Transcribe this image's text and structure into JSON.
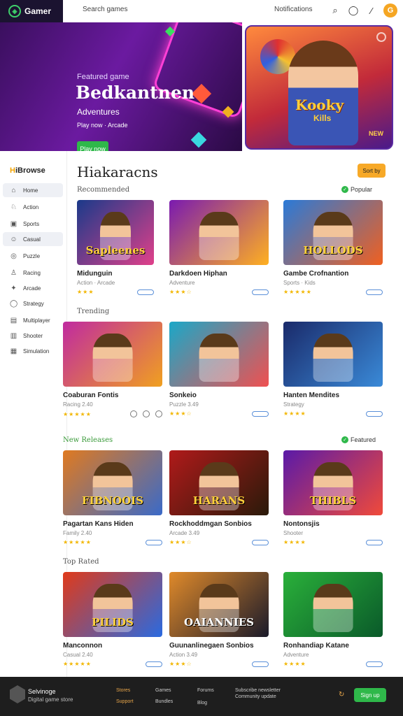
{
  "topbar": {
    "brand": "Gamer",
    "search_placeholder": "Search games",
    "account_label": "Notifications",
    "avatar_initial": "G"
  },
  "hero": {
    "eyebrow": "Featured game",
    "title": "Bedkantnen",
    "subtitle": "Adventures",
    "meta": "Play now · Arcade",
    "cta": "Play now",
    "art_title": "Kooky",
    "art_subtitle": "Kills",
    "art_badge": "NEW"
  },
  "sidebar": {
    "title_highlight": "H",
    "title_rest": "iBrowse",
    "items": [
      {
        "icon": "⌂",
        "label": "Home"
      },
      {
        "icon": "♘",
        "label": "Action"
      },
      {
        "icon": "▣",
        "label": "Sports"
      },
      {
        "icon": "☺",
        "label": "Casual"
      },
      {
        "icon": "◎",
        "label": "Puzzle"
      },
      {
        "icon": "♙",
        "label": "Racing"
      },
      {
        "icon": "✦",
        "label": "Arcade"
      },
      {
        "icon": "◯",
        "label": "Strategy"
      },
      {
        "icon": "▤",
        "label": "Multiplayer"
      },
      {
        "icon": "▥",
        "label": "Shooter"
      },
      {
        "icon": "▦",
        "label": "Simulation"
      }
    ]
  },
  "main": {
    "title": "Hiakaracns",
    "sort_button": "Sort by"
  },
  "sections": [
    {
      "label": "Recommended",
      "tag": "Popular",
      "tag_green": true
    },
    {
      "label": "Trending",
      "tag": "",
      "tag_green": false
    },
    {
      "label": "New Releases",
      "tag": "Featured",
      "tag_green": true
    },
    {
      "label": "Top Rated",
      "tag": "",
      "tag_green": false
    }
  ],
  "games": [
    {
      "name": "Midunguin",
      "meta": "Action · Arcade",
      "stars": "★★★",
      "thumb_text": "Sapleenes",
      "c1": "#1a3a8a",
      "c2": "#e0408a",
      "tc": "#ffcf3a"
    },
    {
      "name": "Darkdoen Hiphan",
      "meta": "Adventure",
      "stars": "★★★☆",
      "thumb_text": "",
      "c1": "#7a1ab0",
      "c2": "#ffb020",
      "tc": "#fff"
    },
    {
      "name": "Gambe Crofnantion",
      "meta": "Sports · Kids",
      "stars": "★★★★★",
      "thumb_text": "HOLLODS",
      "c1": "#2a7ad8",
      "c2": "#f06020",
      "tc": "#ffd23a"
    },
    {
      "name": "Coaburan Fontis",
      "meta": "Racing 2.40",
      "stars": "★★★★★",
      "thumb_text": "",
      "c1": "#c02aa0",
      "c2": "#f0a020",
      "tc": "#fff"
    },
    {
      "name": "Sonkeio",
      "meta": "Puzzle 3.49",
      "stars": "★★★☆",
      "thumb_text": "",
      "c1": "#1aa8c8",
      "c2": "#f05050",
      "tc": "#fff"
    },
    {
      "name": "Hanten Mendites",
      "meta": "Strategy",
      "stars": "★★★★",
      "thumb_text": "",
      "c1": "#1a2a6a",
      "c2": "#3a8ad8",
      "tc": "#fff"
    },
    {
      "name": "Pagartan Kans Hiden",
      "meta": "Family 2.40",
      "stars": "★★★★★",
      "thumb_text": "FIBNOOIS",
      "c1": "#e07a20",
      "c2": "#3a6ac8",
      "tc": "#ffd23a"
    },
    {
      "name": "Rockhoddmgan Sonbios",
      "meta": "Arcade 3.49",
      "stars": "★★★☆",
      "thumb_text": "HARANS",
      "c1": "#b01a1a",
      "c2": "#2a1a0a",
      "tc": "#ffcf3a"
    },
    {
      "name": "Nontonsjis",
      "meta": "Shooter",
      "stars": "★★★★",
      "thumb_text": "THIBLS",
      "c1": "#5a1aa8",
      "c2": "#f04a3a",
      "tc": "#ffd23a"
    },
    {
      "name": "Manconnon",
      "meta": "Casual 2.40",
      "stars": "★★★★★",
      "thumb_text": "PILIDS",
      "c1": "#e03a1a",
      "c2": "#2a6ae0",
      "tc": "#ffcf3a"
    },
    {
      "name": "Guunanlinegaen Sonbios",
      "meta": "Action 3.49",
      "stars": "★★★☆",
      "thumb_text": "OAIANNIES",
      "c1": "#e08a2a",
      "c2": "#1a1a2a",
      "tc": "#fff"
    },
    {
      "name": "Ronhandiap Katane",
      "meta": "Adventure",
      "stars": "★★★★",
      "thumb_text": "",
      "c1": "#2ab03a",
      "c2": "#0a5a2a",
      "tc": "#fff"
    }
  ],
  "footer": {
    "brand": "Selvinoge",
    "tagline": "Digital game store",
    "links_a": [
      "Stores",
      "Support"
    ],
    "links_b": [
      "Games",
      "Bundles"
    ],
    "links_c": [
      "Forums",
      "Blog"
    ],
    "links_d": [
      "Subscribe newsletter",
      "Community update"
    ],
    "button": "Sign up"
  },
  "colors": {
    "accent": "#2fb84a",
    "orange": "#f7a928",
    "hero": "#4a1a78"
  }
}
